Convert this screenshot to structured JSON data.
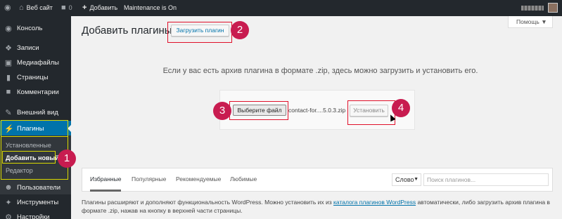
{
  "adminbar": {
    "site_name": "Веб сайт",
    "comments_count": "0",
    "add_label": "Добавить",
    "maintenance": "Maintenance is On",
    "wp_icon": "wordpress-icon",
    "home_icon": "home-icon",
    "comment_icon": "comment-icon",
    "plus_icon": "plus-icon"
  },
  "sidebar": {
    "items": [
      {
        "label": "Консоль",
        "icon": "dashboard-icon"
      },
      {
        "label": "Записи",
        "icon": "pin-icon"
      },
      {
        "label": "Медиафайлы",
        "icon": "media-icon"
      },
      {
        "label": "Страницы",
        "icon": "page-icon"
      },
      {
        "label": "Комментарии",
        "icon": "comment-icon"
      },
      {
        "label": "Внешний вид",
        "icon": "brush-icon"
      },
      {
        "label": "Плагины",
        "icon": "plug-icon"
      },
      {
        "label": "Пользователи",
        "icon": "users-icon"
      },
      {
        "label": "Инструменты",
        "icon": "wrench-icon"
      },
      {
        "label": "Настройки",
        "icon": "settings-icon"
      }
    ],
    "submenu": [
      "Установленные",
      "Добавить новый",
      "Редактор"
    ]
  },
  "header": {
    "title": "Добавить плагины",
    "upload_button": "Загрузить плагин",
    "help_button": "Помощь ▼"
  },
  "upload": {
    "intro": "Если у вас есть архив плагина в формате .zip, здесь можно загрузить и установить его.",
    "choose_file": "Выберите файл",
    "file_name": "contact-for....5.0.3.zip",
    "install_button": "Установить"
  },
  "filter": {
    "tabs": [
      "Избранные",
      "Популярные",
      "Рекомендуемые",
      "Любимые"
    ],
    "select_value": "Слово",
    "search_placeholder": "Поиск плагинов..."
  },
  "description": {
    "before_link": "Плагины расширяют и дополняют функциональность WordPress. Можно установить их из ",
    "link": "каталога плагинов WordPress",
    "after_link": " автоматически, либо загрузить архив плагина в формате .zip, нажав на кнопку в верхней части страницы."
  },
  "badges": [
    "1",
    "2",
    "3",
    "4"
  ],
  "colors": {
    "admin_dark": "#23282d",
    "accent_blue": "#0073aa",
    "badge": "#c81c50",
    "highlight_yellow": "#d9d900",
    "highlight_red": "#e0102a"
  }
}
